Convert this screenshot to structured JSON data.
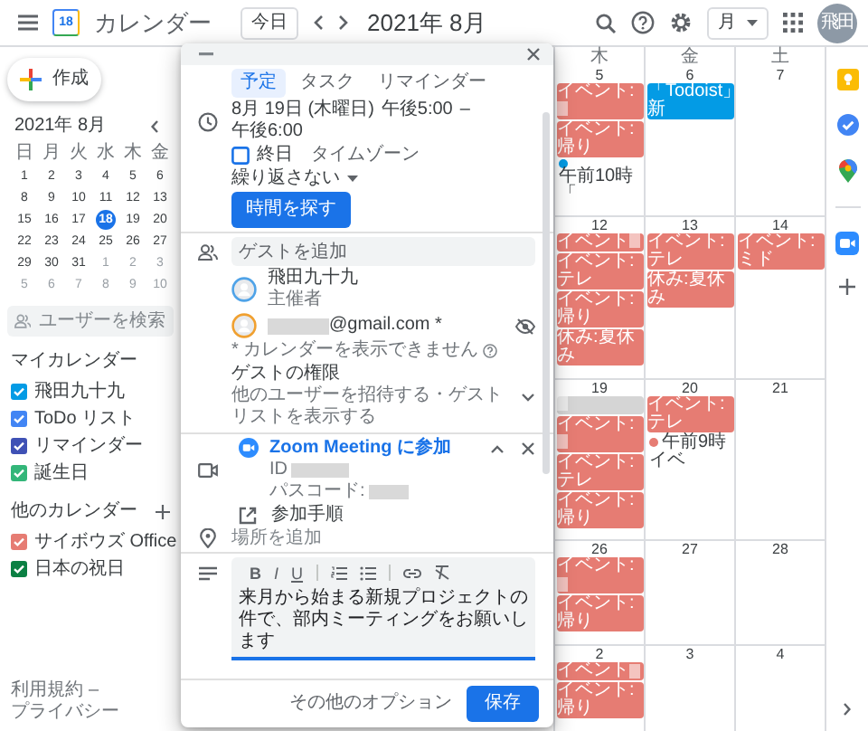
{
  "topbar": {
    "logo_day": "18",
    "app_name": "カレンダー",
    "today_button": "今日",
    "title": "2021年 8月",
    "view_select": "月",
    "avatar": "飛田"
  },
  "sidebar": {
    "create_button": "作成",
    "mini_calendar": {
      "title": "2021年 8月",
      "weekdays": [
        "日",
        "月",
        "火",
        "水",
        "木",
        "金"
      ],
      "weeks": [
        [
          {
            "d": "1",
            "muted": false,
            "selected": false
          },
          {
            "d": "2",
            "muted": false,
            "selected": false
          },
          {
            "d": "3",
            "muted": false,
            "selected": false
          },
          {
            "d": "4",
            "muted": false,
            "selected": false
          },
          {
            "d": "5",
            "muted": false,
            "selected": false
          },
          {
            "d": "6",
            "muted": false,
            "selected": false
          }
        ],
        [
          {
            "d": "8",
            "muted": false,
            "selected": false
          },
          {
            "d": "9",
            "muted": false,
            "selected": false
          },
          {
            "d": "10",
            "muted": false,
            "selected": false
          },
          {
            "d": "11",
            "muted": false,
            "selected": false
          },
          {
            "d": "12",
            "muted": false,
            "selected": false
          },
          {
            "d": "13",
            "muted": false,
            "selected": false
          }
        ],
        [
          {
            "d": "15",
            "muted": false,
            "selected": false
          },
          {
            "d": "16",
            "muted": false,
            "selected": false
          },
          {
            "d": "17",
            "muted": false,
            "selected": false
          },
          {
            "d": "18",
            "muted": false,
            "selected": true
          },
          {
            "d": "19",
            "muted": false,
            "selected": false
          },
          {
            "d": "20",
            "muted": false,
            "selected": false
          }
        ],
        [
          {
            "d": "22",
            "muted": false,
            "selected": false
          },
          {
            "d": "23",
            "muted": false,
            "selected": false
          },
          {
            "d": "24",
            "muted": false,
            "selected": false
          },
          {
            "d": "25",
            "muted": false,
            "selected": false
          },
          {
            "d": "26",
            "muted": false,
            "selected": false
          },
          {
            "d": "27",
            "muted": false,
            "selected": false
          }
        ],
        [
          {
            "d": "29",
            "muted": false,
            "selected": false
          },
          {
            "d": "30",
            "muted": false,
            "selected": false
          },
          {
            "d": "31",
            "muted": false,
            "selected": false
          },
          {
            "d": "1",
            "muted": true,
            "selected": false
          },
          {
            "d": "2",
            "muted": true,
            "selected": false
          },
          {
            "d": "3",
            "muted": true,
            "selected": false
          }
        ],
        [
          {
            "d": "5",
            "muted": true,
            "selected": false
          },
          {
            "d": "6",
            "muted": true,
            "selected": false
          },
          {
            "d": "7",
            "muted": true,
            "selected": false
          },
          {
            "d": "8",
            "muted": true,
            "selected": false
          },
          {
            "d": "9",
            "muted": true,
            "selected": false
          },
          {
            "d": "10",
            "muted": true,
            "selected": false
          }
        ]
      ]
    },
    "user_search": {
      "placeholder": "ユーザーを検索"
    },
    "my_calendars": {
      "title": "マイカレンダー",
      "items": [
        {
          "name": "飛田九十九",
          "checked": true,
          "color": "#039be5"
        },
        {
          "name": "ToDo リスト",
          "checked": true,
          "color": "#4285f4"
        },
        {
          "name": "リマインダー",
          "checked": true,
          "color": "#3f51b5"
        },
        {
          "name": "誕生日",
          "checked": true,
          "color": "#33b679"
        }
      ]
    },
    "other_calendars": {
      "title": "他のカレンダー",
      "items": [
        {
          "name": "サイボウズ Office",
          "checked": true,
          "color": "#e67c73"
        },
        {
          "name": "日本の祝日",
          "checked": true,
          "color": "#0b8043"
        }
      ]
    },
    "footer": {
      "terms": "利用規約",
      "separator": "–",
      "privacy": "プライバシー"
    }
  },
  "calendar": {
    "weekdays": [
      "木",
      "金",
      "土"
    ],
    "weeks": [
      {
        "days": [
          {
            "date": "5",
            "events": [
              {
                "kind": "chip",
                "text": "イベント:",
                "redacted": true,
                "color": "#e67c73"
              },
              {
                "kind": "chip",
                "text": "イベント:帰り",
                "redacted": false,
                "color": "#e67c73"
              },
              {
                "kind": "dot",
                "time": "午前10時",
                "text": "「",
                "color": "#039be5"
              }
            ]
          },
          {
            "date": "6",
            "events": [
              {
                "kind": "chip",
                "text": "「Todoist」新",
                "redacted": false,
                "color": "#039be5"
              }
            ]
          },
          {
            "date": "7"
          }
        ]
      },
      {
        "days": [
          {
            "date": "12",
            "events": [
              {
                "kind": "chip",
                "text": "イベント",
                "redacted": true,
                "color": "#e67c73"
              },
              {
                "kind": "chip",
                "text": "イベント:テレ",
                "redacted": false,
                "color": "#e67c73"
              },
              {
                "kind": "chip",
                "text": "イベント:帰り",
                "redacted": false,
                "color": "#e67c73"
              },
              {
                "kind": "chip",
                "text": "休み:夏休み",
                "redacted": false,
                "color": "#e67c73"
              }
            ]
          },
          {
            "date": "13",
            "events": [
              {
                "kind": "chip",
                "text": "イベント:テレ",
                "redacted": false,
                "color": "#e67c73"
              },
              {
                "kind": "chip",
                "text": "休み:夏休み",
                "redacted": false,
                "color": "#e67c73"
              }
            ]
          },
          {
            "date": "14",
            "events": [
              {
                "kind": "chip",
                "text": "イベント:ミド",
                "redacted": false,
                "color": "#e67c73"
              }
            ]
          }
        ]
      },
      {
        "days": [
          {
            "date": "19",
            "events": [
              {
                "kind": "chip",
                "redacted": true,
                "color": "#d5d5d5"
              },
              {
                "kind": "chip",
                "text": "イベント:",
                "redacted": true,
                "color": "#e67c73"
              },
              {
                "kind": "chip",
                "text": "イベント:テレ",
                "redacted": false,
                "color": "#e67c73"
              },
              {
                "kind": "chip",
                "text": "イベント:帰り",
                "redacted": false,
                "color": "#e67c73"
              }
            ]
          },
          {
            "date": "20",
            "events": [
              {
                "kind": "chip",
                "text": "イベント:テレ",
                "redacted": false,
                "color": "#e67c73"
              },
              {
                "kind": "dot",
                "time": "午前9時",
                "text": "イベ",
                "color": "#e67c73"
              }
            ]
          },
          {
            "date": "21"
          }
        ]
      },
      {
        "days": [
          {
            "date": "26",
            "events": [
              {
                "kind": "chip",
                "text": "イベント:",
                "redacted": true,
                "color": "#e67c73"
              },
              {
                "kind": "chip",
                "text": "イベント:帰り",
                "redacted": false,
                "color": "#e67c73"
              }
            ]
          },
          {
            "date": "27"
          },
          {
            "date": "28"
          }
        ]
      },
      {
        "days": [
          {
            "date": "2",
            "events": [
              {
                "kind": "chip",
                "text": "イベント",
                "redacted": true,
                "color": "#e67c73"
              },
              {
                "kind": "chip",
                "text": "イベント:帰り",
                "redacted": false,
                "color": "#e67c73"
              }
            ]
          },
          {
            "date": "3"
          },
          {
            "date": "4"
          }
        ]
      }
    ]
  },
  "dialog": {
    "tabs": [
      {
        "label": "予定",
        "selected": true
      },
      {
        "label": "タスク",
        "selected": false
      },
      {
        "label": "リマインダー",
        "selected": false
      }
    ],
    "date": "8月 19日 (木曜日)",
    "start_time": "午後5:00",
    "dash": "–",
    "end_time": "午後6:00",
    "all_day": {
      "label": "終日",
      "checked": false
    },
    "timezone_link": "タイムゾーン",
    "repeat": "繰り返さない",
    "find_time_button": "時間を探す",
    "guest_field": {
      "placeholder": "ゲストを追加"
    },
    "guests": [
      {
        "name": "飛田九十九",
        "role": "主催者",
        "color": "#4fa3e8",
        "redacted": false,
        "calendar_hidden": false
      },
      {
        "name": "@gmail.com *",
        "color": "#f0a030",
        "redacted": true,
        "calendar_hidden": true
      }
    ],
    "guest_note": "* カレンダーを表示できません",
    "permissions": {
      "title": "ゲストの権限",
      "subtitle": "他のユーザーを招待する・ゲストリストを表示する",
      "expanded": false
    },
    "conference": {
      "link": "Zoom Meeting に参加",
      "id_label": "ID",
      "passcode_label": "パスコード:",
      "redacted": true,
      "expanded": true
    },
    "instructions_link": "参加手順",
    "location_field": {
      "placeholder": "場所を追加"
    },
    "description": {
      "toolbar": [
        {
          "kind": "bold",
          "label": "B"
        },
        {
          "kind": "italic",
          "label": "I"
        },
        {
          "kind": "underline",
          "label": "U"
        },
        {
          "kind": "separator"
        },
        {
          "kind": "numbered"
        },
        {
          "kind": "bulleted"
        },
        {
          "kind": "separator"
        },
        {
          "kind": "link"
        },
        {
          "kind": "clear"
        }
      ],
      "value": "来月から始まる新規プロジェクトの件で、部内ミーティングをお願いします"
    },
    "more_options_button": "その他のオプション",
    "save_button": "保存"
  }
}
